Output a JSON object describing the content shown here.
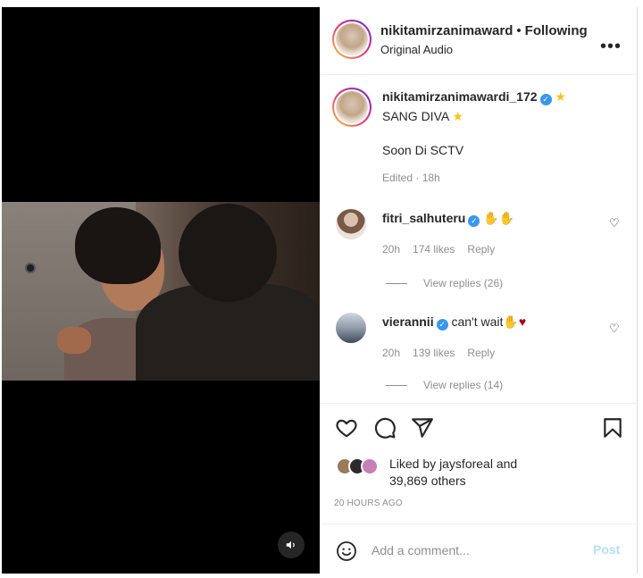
{
  "header": {
    "username": "nikitamirzanimaward",
    "separator": "•",
    "follow_status": "Following",
    "audio": "Original Audio",
    "more": "•••"
  },
  "caption": {
    "username": "nikitamirzanimawardi_172",
    "verified_mark": "✓",
    "star": "★",
    "line1": "SANG DIVA",
    "line2": "Soon Di SCTV",
    "meta": "Edited · 18h"
  },
  "comments": [
    {
      "username": "fitri_salhuteru",
      "text": "✋✋",
      "time": "20h",
      "likes": "174 likes",
      "reply": "Reply",
      "view_replies": "View replies (26)",
      "heart": "♡"
    },
    {
      "username": "vierannii",
      "text": "can't wait✋",
      "heart_emoji": "♥",
      "time": "20h",
      "likes": "139 likes",
      "reply": "Reply",
      "view_replies": "View replies (14)",
      "heart": "♡"
    }
  ],
  "likes": {
    "line1": "Liked by jaysforeal and",
    "line2": "39,869 others"
  },
  "time_ago": "20 HOURS AGO",
  "add_comment": {
    "placeholder": "Add a comment...",
    "post_label": "Post"
  },
  "icons": {
    "like": "heart-icon",
    "comment": "comment-icon",
    "share": "share-icon",
    "save": "bookmark-icon",
    "sound": "speaker-icon",
    "emoji": "emoji-icon"
  }
}
